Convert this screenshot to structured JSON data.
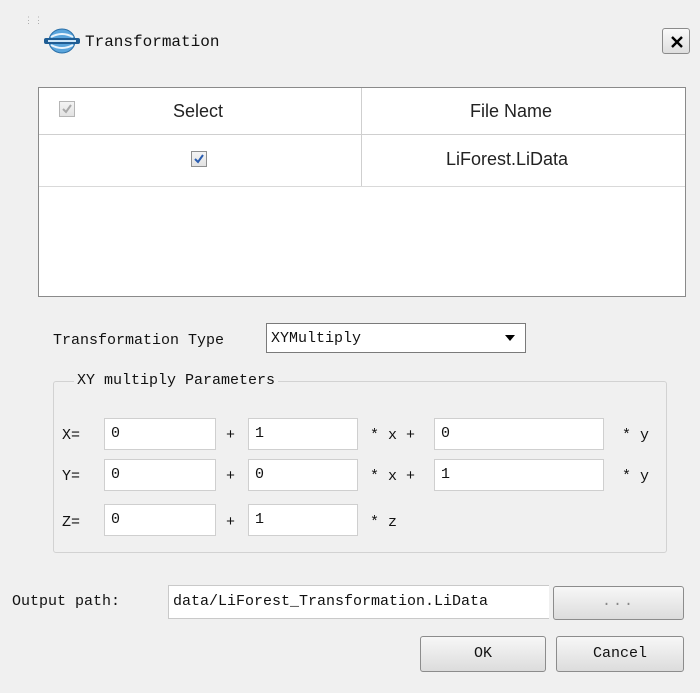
{
  "window": {
    "title": "Transformation",
    "logo_icon": "lidar-globe-logo",
    "close_icon": "close-icon"
  },
  "file_table": {
    "headers": {
      "select": "Select",
      "file_name": "File Name"
    },
    "select_all_checked": true,
    "rows": [
      {
        "checked": true,
        "file_name": "LiForest.LiData"
      }
    ]
  },
  "transformation_type": {
    "label": "Transformation Type",
    "selected": "XYMultiply"
  },
  "params": {
    "legend": "XY multiply Parameters",
    "x": {
      "label": "X=",
      "c0": "0",
      "c1": "1",
      "c2": "0"
    },
    "y": {
      "label": "Y=",
      "c0": "0",
      "c1": "0",
      "c2": "1"
    },
    "z": {
      "label": "Z=",
      "c0": "0",
      "c1": "1"
    },
    "plus": "+",
    "times_x_plus": "* x +",
    "times_y": "* y",
    "times_z": "* z"
  },
  "output": {
    "label": "Output path:",
    "value": "data/LiForest_Transformation.LiData",
    "browse_label": "..."
  },
  "buttons": {
    "ok": "OK",
    "cancel": "Cancel"
  },
  "colors": {
    "check_blue": "#2a5db0",
    "disabled_check": "#a9a9a9"
  }
}
